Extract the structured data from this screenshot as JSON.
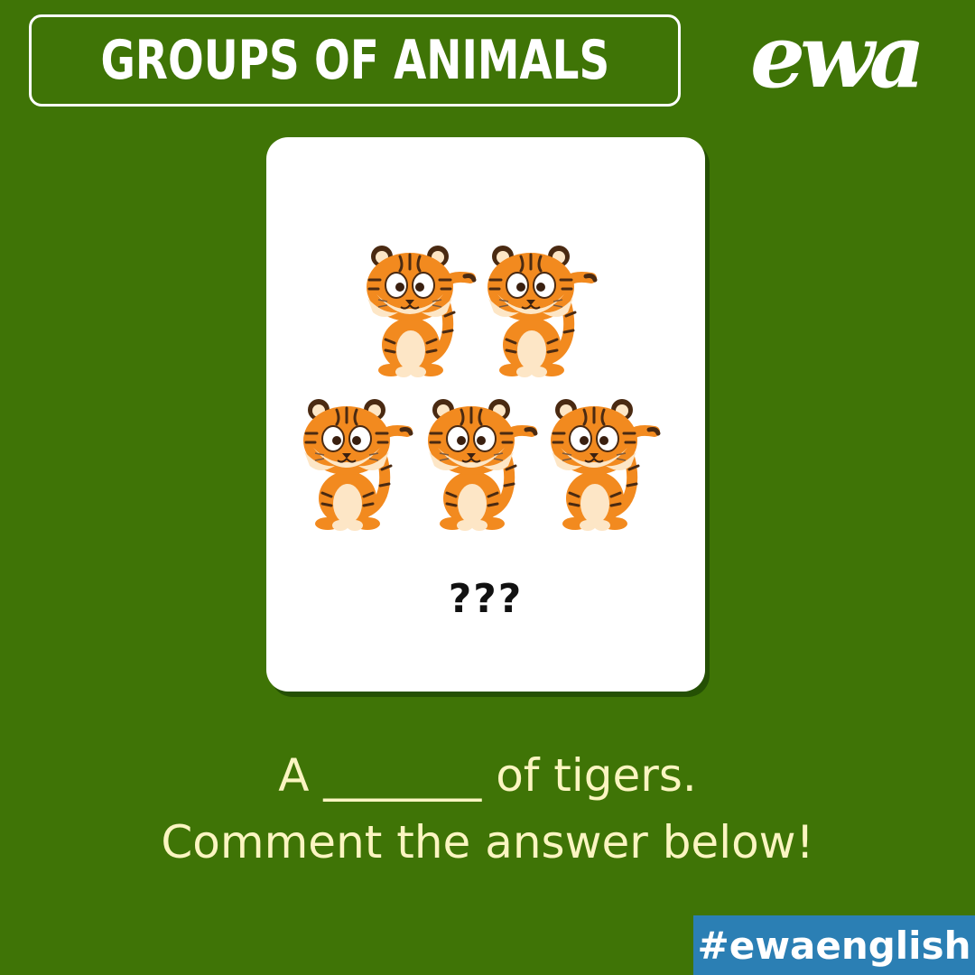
{
  "header": {
    "title": "GROUPS OF ANIMALS",
    "logo_text": "ewa"
  },
  "card": {
    "question_marks": "???",
    "animal_icon": "tiger-icon",
    "animal_count": 5,
    "rows": [
      2,
      3
    ]
  },
  "prompt": {
    "line1": "A _______ of tigers.",
    "line2": "Comment the answer below!"
  },
  "footer": {
    "hashtag": "#ewaenglish"
  },
  "colors": {
    "background": "#3f7406",
    "card": "#ffffff",
    "prompt_text": "#fbf5c1",
    "hashtag_bg": "#2b7fb4",
    "tiger_orange": "#f28a1f"
  }
}
